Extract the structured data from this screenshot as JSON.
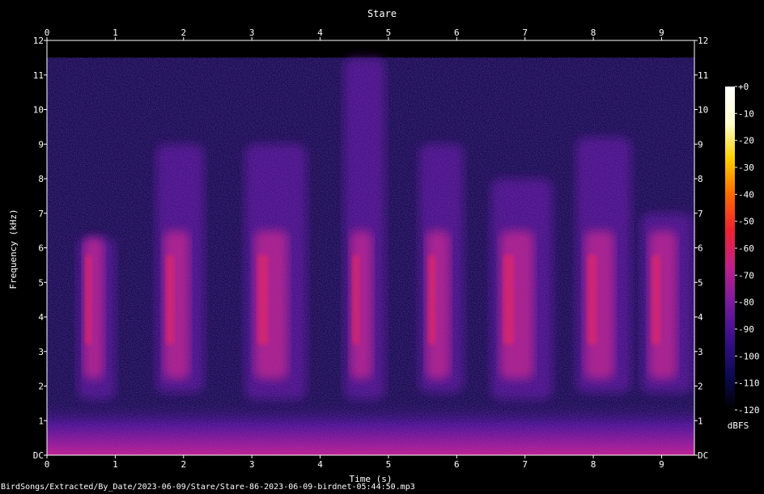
{
  "chart_data": {
    "type": "heatmap",
    "title": "Stare",
    "xlabel": "Time (s)",
    "ylabel": "Frequency (kHz)",
    "xlim": [
      0,
      9.48
    ],
    "ylim": [
      0,
      12
    ],
    "x_ticks": [
      "0",
      "1",
      "2",
      "3",
      "4",
      "5",
      "6",
      "7",
      "8",
      "9"
    ],
    "y_ticks": [
      "DC",
      "1",
      "2",
      "3",
      "4",
      "5",
      "6",
      "7",
      "8",
      "9",
      "10",
      "11",
      "12"
    ],
    "colorbar": {
      "label": "dBFS",
      "ticks": [
        "+0",
        "-10",
        "-20",
        "-30",
        "-40",
        "-50",
        "-60",
        "-70",
        "-80",
        "-90",
        "-100",
        "-110",
        "-120"
      ],
      "range": [
        -120,
        0
      ],
      "colors": [
        "#000000",
        "#0d0a55",
        "#3a0f8c",
        "#7a1aa0",
        "#c0208a",
        "#f02030",
        "#ff6a00",
        "#ffd000",
        "#ffffd0",
        "#ffffff"
      ]
    },
    "spectral_content_cutoff_khz": 11.5,
    "calls": [
      {
        "start": 0.45,
        "end": 1.0,
        "f_low": 1.6,
        "f_high": 6.3
      },
      {
        "start": 1.6,
        "end": 2.3,
        "f_low": 1.8,
        "f_high": 9.0
      },
      {
        "start": 2.9,
        "end": 3.8,
        "f_low": 1.6,
        "f_high": 9.0
      },
      {
        "start": 4.35,
        "end": 4.95,
        "f_low": 1.6,
        "f_high": 11.5
      },
      {
        "start": 5.45,
        "end": 6.1,
        "f_low": 1.8,
        "f_high": 9.0
      },
      {
        "start": 6.5,
        "end": 7.4,
        "f_low": 1.6,
        "f_high": 8.0
      },
      {
        "start": 7.75,
        "end": 8.55,
        "f_low": 1.8,
        "f_high": 9.2
      },
      {
        "start": 8.7,
        "end": 9.45,
        "f_low": 1.8,
        "f_high": 7.0
      }
    ]
  },
  "footer": {
    "filename": "BirdSongs/Extracted/By_Date/2023-06-09/Stare/Stare-86-2023-06-09-birdnet-05:44:50.mp3"
  }
}
